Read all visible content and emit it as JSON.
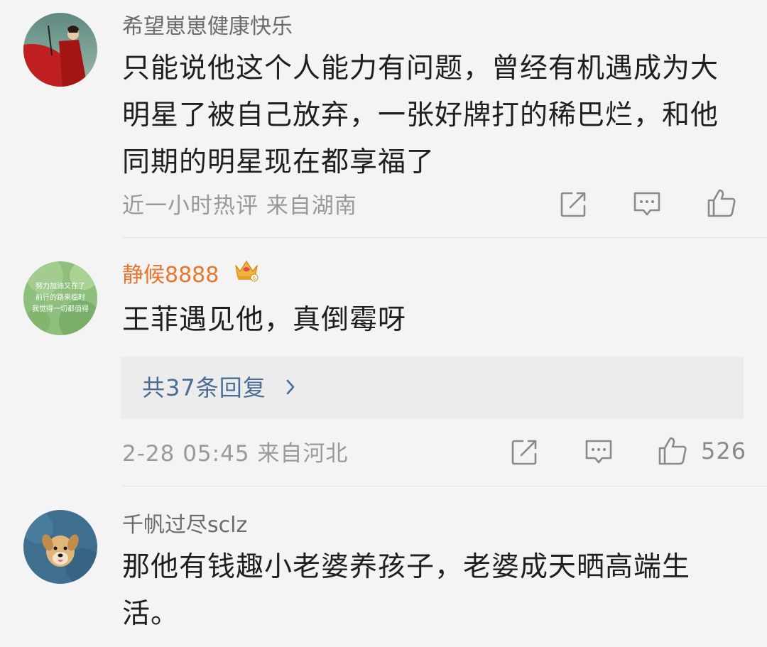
{
  "comments": [
    {
      "username": "希望崽崽健康快乐",
      "text": "只能说他这个人能力有问题，曾经有机遇成为大明星了被自己放弃，一张好牌打的稀巴烂，和他同期的明星现在都享福了",
      "meta": "近一小时热评  来自湖南",
      "avatar_icon": "red-cloak-figure-avatar"
    },
    {
      "username": "静候8888",
      "vip_icon": "vip-crown-badge-icon",
      "text": "王菲遇见他，真倒霉呀",
      "replies_label": "共37条回复",
      "meta": "2-28 05:45  来自河北",
      "like_count": "526",
      "avatar_icon": "green-text-avatar",
      "avatar_text_lines": [
        "努力加油又在了",
        "前行的路来临时",
        "我觉得一切都值得"
      ]
    },
    {
      "username": "千帆过尽sclz",
      "text": "那他有钱趣小老婆养孩子，老婆成天晒高端生活。",
      "avatar_icon": "dog-avatar"
    }
  ],
  "icons": {
    "share": "share-icon",
    "reply": "comment-icon",
    "like": "thumbs-up-icon",
    "more_replies": "chevron-right-icon"
  },
  "colors": {
    "background": "#f4f4f4",
    "username": "#6b6b6b",
    "vip_username": "#e8762c",
    "text": "#1f1f1f",
    "meta": "#9a9a9a",
    "reply_link": "#4a6d95",
    "reply_box": "#ececec"
  }
}
